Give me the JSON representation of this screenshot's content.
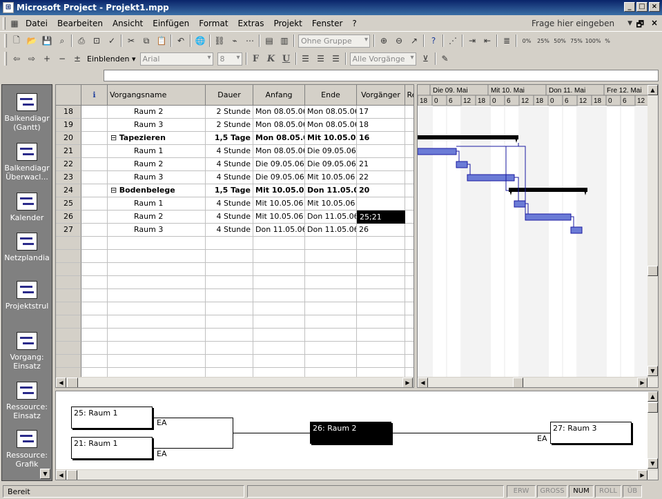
{
  "window": {
    "title": "Microsoft Project - Projekt1.mpp",
    "controls": [
      "_",
      "□",
      "×"
    ]
  },
  "menu": {
    "items": [
      "Datei",
      "Bearbeiten",
      "Ansicht",
      "Einfügen",
      "Format",
      "Extras",
      "Projekt",
      "Fenster",
      "?"
    ],
    "help_placeholder": "Frage hier eingeben",
    "mdi_controls": [
      "🗗",
      "×"
    ]
  },
  "toolbar": {
    "group_combo": "Ohne Gruppe",
    "zoom_labels": [
      "0%",
      "25%",
      "50%",
      "75%",
      "100%",
      "%"
    ]
  },
  "format_toolbar": {
    "show_label": "Einblenden ▾",
    "font": "Arial",
    "size": "8",
    "bold": "F",
    "italic": "K",
    "underline": "U",
    "filter": "Alle Vorgänge"
  },
  "viewbar": {
    "items": [
      "Balkendiagr (Gantt)",
      "Balkendiagr Überwacl...",
      "Kalender",
      "Netzplandia",
      "Projektstrul",
      "Vorgang: Einsatz",
      "Ressource: Einsatz",
      "Ressource: Grafik"
    ]
  },
  "table": {
    "columns": [
      "",
      "ℹ",
      "Vorgangsname",
      "Dauer",
      "Anfang",
      "Ende",
      "Vorgänger",
      "Re"
    ],
    "rows": [
      {
        "id": "18",
        "name": "Raum 2",
        "dur": "2 Stunde",
        "start": "Mon 08.05.06",
        "end": "Mon 08.05.06",
        "pred": "17",
        "level": 2,
        "summary": false
      },
      {
        "id": "19",
        "name": "Raum 3",
        "dur": "2 Stunde",
        "start": "Mon 08.05.06",
        "end": "Mon 08.05.06",
        "pred": "18",
        "level": 2,
        "summary": false
      },
      {
        "id": "20",
        "name": "Tapezieren",
        "dur": "1,5 Tage",
        "start": "Mon 08.05.06",
        "end": "Mit 10.05.06",
        "pred": "16",
        "level": 1,
        "summary": true
      },
      {
        "id": "21",
        "name": "Raum 1",
        "dur": "4 Stunde",
        "start": "Mon 08.05.06",
        "end": "Die 09.05.06",
        "pred": "",
        "level": 2,
        "summary": false
      },
      {
        "id": "22",
        "name": "Raum 2",
        "dur": "4 Stunde",
        "start": "Die 09.05.06",
        "end": "Die 09.05.06",
        "pred": "21",
        "level": 2,
        "summary": false
      },
      {
        "id": "23",
        "name": "Raum 3",
        "dur": "4 Stunde",
        "start": "Die 09.05.06",
        "end": "Mit 10.05.06",
        "pred": "22",
        "level": 2,
        "summary": false
      },
      {
        "id": "24",
        "name": "Bodenbelege",
        "dur": "1,5 Tage",
        "start": "Mit 10.05.06",
        "end": "Don 11.05.06",
        "pred": "20",
        "level": 1,
        "summary": true
      },
      {
        "id": "25",
        "name": "Raum 1",
        "dur": "4 Stunde",
        "start": "Mit 10.05.06",
        "end": "Mit 10.05.06",
        "pred": "",
        "level": 2,
        "summary": false
      },
      {
        "id": "26",
        "name": "Raum 2",
        "dur": "4 Stunde",
        "start": "Mit 10.05.06",
        "end": "Don 11.05.06",
        "pred": "25;21",
        "level": 2,
        "summary": false,
        "selected_pred": true
      },
      {
        "id": "27",
        "name": "Raum 3",
        "dur": "4 Stunde",
        "start": "Don 11.05.06",
        "end": "Don 11.05.06",
        "pred": "26",
        "level": 2,
        "summary": false
      }
    ],
    "collapse_symbol": "⊟"
  },
  "gantt": {
    "days": [
      "Die 09. Mai",
      "Mit 10. Mai",
      "Don 11. Mai",
      "Fre 12. Mai"
    ],
    "hours": [
      "18",
      "0",
      "6",
      "12",
      "18",
      "0",
      "6",
      "12",
      "18",
      "0",
      "6",
      "12",
      "18",
      "0",
      "6",
      "12"
    ]
  },
  "network": {
    "boxes": [
      {
        "label": "25: Raum 1",
        "tag": "EA"
      },
      {
        "label": "21: Raum 1",
        "tag": "EA"
      },
      {
        "label": "26: Raum 2",
        "tag": ""
      },
      {
        "label": "27: Raum 3",
        "tag": "EA"
      }
    ]
  },
  "status": {
    "text": "Bereit",
    "indicators": [
      "ERW",
      "GROSS",
      "NUM",
      "ROLL",
      "ÜB"
    ]
  },
  "colors": {
    "titlebar": "#0a246a",
    "task_bar": "#6b7bd6",
    "summary_bar": "#000000",
    "link": "#1a1aa0"
  }
}
